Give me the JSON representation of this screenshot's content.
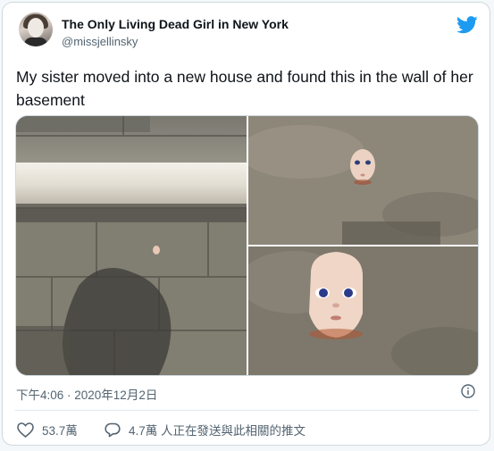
{
  "author": {
    "display_name": "The Only Living Dead Girl in New York",
    "handle": "@missjellinsky"
  },
  "brand": {
    "icon": "twitter-bird-icon",
    "color": "#1d9bf0"
  },
  "tweet": {
    "text": "My sister moved into a new house and found this in the wall of her basement",
    "images": [
      {
        "icon": "basement-wall-photo"
      },
      {
        "icon": "doll-face-in-wall-photo"
      },
      {
        "icon": "doll-face-closeup-photo"
      }
    ],
    "timestamp": "下午4:06 · 2020年12月2日"
  },
  "actions": {
    "likes": "53.7萬",
    "replies_text": "4.7萬 人正在發送與此相關的推文"
  },
  "colors": {
    "text_primary": "#0f1419",
    "text_secondary": "#536471",
    "border": "#cfd9de"
  }
}
